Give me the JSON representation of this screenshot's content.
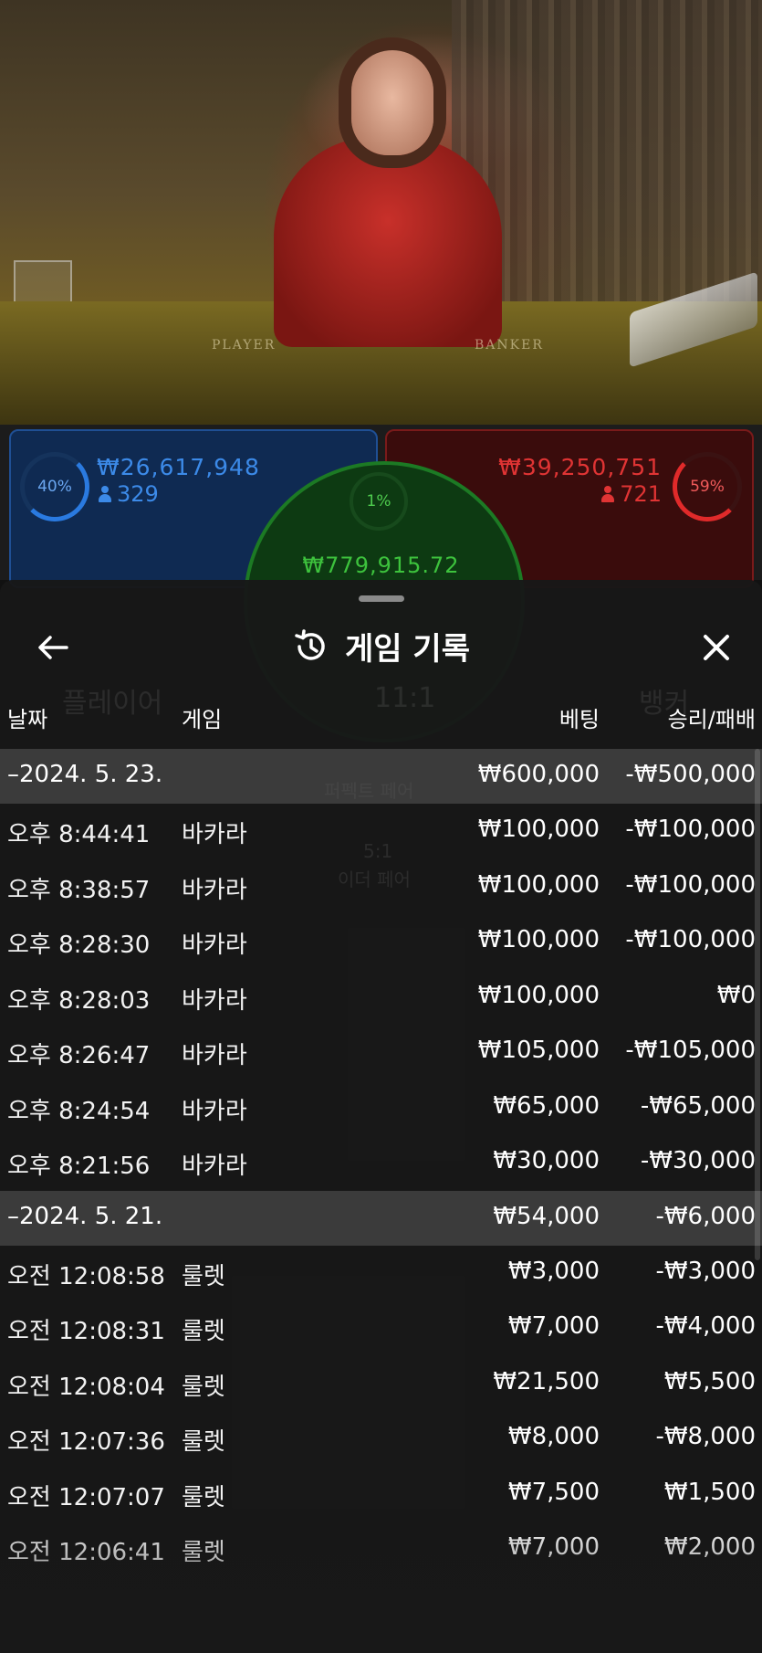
{
  "video": {
    "felt_left": "PLAYER",
    "felt_right": "BANKER"
  },
  "stats": {
    "player": {
      "percent": "40%",
      "amount": "₩26,617,948",
      "count": "329"
    },
    "banker": {
      "percent": "59%",
      "amount": "₩39,250,751",
      "count": "721"
    },
    "tie": {
      "percent": "1%",
      "amount": "₩779,915.72"
    },
    "colors": {
      "player": "#3c8ae8",
      "banker": "#e03434",
      "tie": "#3dc23d"
    }
  },
  "background_ghost": {
    "player_label": "플레이어",
    "tie_ratio": "11:1",
    "banker_label": "뱅커",
    "perfect_pair": "퍼펙트 페어",
    "either_pair_ratio": "5:1",
    "either_pair": "이더 페어"
  },
  "sheet": {
    "title": "게임 기록",
    "icons": {
      "back": "arrow-left-icon",
      "history": "history-icon",
      "close": "close-icon"
    },
    "columns": {
      "date": "날짜",
      "game": "게임",
      "bet": "베팅",
      "result": "승리/패배"
    },
    "groups": [
      {
        "date": "–2024. 5. 23.",
        "bet": "₩600,000",
        "result": "-₩500,000",
        "rows": [
          {
            "time": "오후 8:44:41",
            "game": "바카라",
            "bet": "₩100,000",
            "result": "-₩100,000"
          },
          {
            "time": "오후 8:38:57",
            "game": "바카라",
            "bet": "₩100,000",
            "result": "-₩100,000"
          },
          {
            "time": "오후 8:28:30",
            "game": "바카라",
            "bet": "₩100,000",
            "result": "-₩100,000"
          },
          {
            "time": "오후 8:28:03",
            "game": "바카라",
            "bet": "₩100,000",
            "result": "₩0"
          },
          {
            "time": "오후 8:26:47",
            "game": "바카라",
            "bet": "₩105,000",
            "result": "-₩105,000"
          },
          {
            "time": "오후 8:24:54",
            "game": "바카라",
            "bet": "₩65,000",
            "result": "-₩65,000"
          },
          {
            "time": "오후 8:21:56",
            "game": "바카라",
            "bet": "₩30,000",
            "result": "-₩30,000"
          }
        ]
      },
      {
        "date": "–2024. 5. 21.",
        "bet": "₩54,000",
        "result": "-₩6,000",
        "rows": [
          {
            "time": "오전 12:08:58",
            "game": "룰렛",
            "bet": "₩3,000",
            "result": "-₩3,000"
          },
          {
            "time": "오전 12:08:31",
            "game": "룰렛",
            "bet": "₩7,000",
            "result": "-₩4,000"
          },
          {
            "time": "오전 12:08:04",
            "game": "룰렛",
            "bet": "₩21,500",
            "result": "₩5,500"
          },
          {
            "time": "오전 12:07:36",
            "game": "룰렛",
            "bet": "₩8,000",
            "result": "-₩8,000"
          },
          {
            "time": "오전 12:07:07",
            "game": "룰렛",
            "bet": "₩7,500",
            "result": "₩1,500"
          },
          {
            "time": "오전 12:06:41",
            "game": "룰렛",
            "bet": "₩7,000",
            "result": "₩2,000"
          }
        ]
      }
    ]
  }
}
